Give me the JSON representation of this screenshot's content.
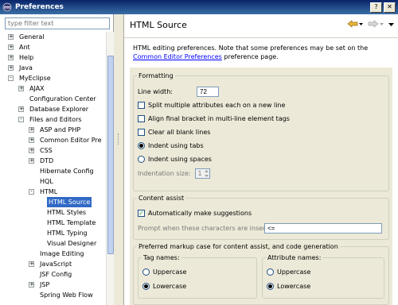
{
  "window": {
    "title": "Preferences"
  },
  "filter": {
    "placeholder": "type filter text"
  },
  "tree": [
    {
      "label": "General",
      "level": 0,
      "expander": "+"
    },
    {
      "label": "Ant",
      "level": 0,
      "expander": "+"
    },
    {
      "label": "Help",
      "level": 0,
      "expander": "+"
    },
    {
      "label": "Java",
      "level": 0,
      "expander": "+"
    },
    {
      "label": "MyEclipse",
      "level": 0,
      "expander": "−"
    },
    {
      "label": "AJAX",
      "level": 1,
      "expander": "+"
    },
    {
      "label": "Configuration Center",
      "level": 1,
      "expander": ""
    },
    {
      "label": "Database Explorer",
      "level": 1,
      "expander": "+"
    },
    {
      "label": "Files and Editors",
      "level": 1,
      "expander": "−"
    },
    {
      "label": "ASP and PHP",
      "level": 2,
      "expander": "+"
    },
    {
      "label": "Common Editor Pre",
      "level": 2,
      "expander": "+"
    },
    {
      "label": "CSS",
      "level": 2,
      "expander": "+"
    },
    {
      "label": "DTD",
      "level": 2,
      "expander": "+"
    },
    {
      "label": "Hibernate Config",
      "level": 2,
      "expander": ""
    },
    {
      "label": "HQL",
      "level": 2,
      "expander": ""
    },
    {
      "label": "HTML",
      "level": 2,
      "expander": "−"
    },
    {
      "label": "HTML Source",
      "level": 3,
      "expander": "",
      "selected": true
    },
    {
      "label": "HTML Styles",
      "level": 3,
      "expander": ""
    },
    {
      "label": "HTML Template",
      "level": 3,
      "expander": ""
    },
    {
      "label": "HTML Typing",
      "level": 3,
      "expander": ""
    },
    {
      "label": "Visual Designer",
      "level": 3,
      "expander": ""
    },
    {
      "label": "Image Editing",
      "level": 2,
      "expander": ""
    },
    {
      "label": "JavaScript",
      "level": 2,
      "expander": "+"
    },
    {
      "label": "JSF Config",
      "level": 2,
      "expander": ""
    },
    {
      "label": "JSP",
      "level": 2,
      "expander": "+"
    },
    {
      "label": "Spring Web Flow",
      "level": 2,
      "expander": ""
    }
  ],
  "page": {
    "title": "HTML Source",
    "description_prefix": "HTML editing preferences.  Note that some preferences may be set on the ",
    "description_link": "Common Editor Preferences",
    "description_suffix": " preference page."
  },
  "formatting": {
    "legend": "Formatting",
    "line_width_label": "Line width:",
    "line_width_value": "72",
    "split_attributes": {
      "label": "Split multiple attributes each on a new line",
      "checked": false
    },
    "align_bracket": {
      "label": "Align final bracket in multi-line element tags",
      "checked": false
    },
    "clear_blank_lines": {
      "label": "Clear all blank lines",
      "checked": false
    },
    "indent_tabs": {
      "label": "Indent using tabs",
      "selected": true
    },
    "indent_spaces": {
      "label": "Indent using spaces",
      "selected": false
    },
    "indentation_size_label": "Indentation size:",
    "indentation_size_value": "1"
  },
  "content_assist": {
    "legend": "Content assist",
    "auto_suggest": {
      "label": "Automatically make suggestions",
      "checked": true
    },
    "prompt_label": "Prompt when these characters are inserted:",
    "prompt_value": "<="
  },
  "markup_case": {
    "legend": "Preferred markup case for content assist, and code generation",
    "tag_names": {
      "legend": "Tag names:",
      "upper": "Uppercase",
      "lower": "Lowercase",
      "selected": "lower"
    },
    "attribute_names": {
      "legend": "Attribute names:",
      "upper": "Uppercase",
      "lower": "Lowercase",
      "selected": "lower"
    }
  },
  "colors": {
    "selection": "#316ac5",
    "link": "#0000ff",
    "titlebar": "#0a246a",
    "nav_arrow": "#e5b33b"
  },
  "icons": {
    "back": "back-arrow-icon",
    "forward": "forward-arrow-icon",
    "menu": "dropdown-icon"
  }
}
